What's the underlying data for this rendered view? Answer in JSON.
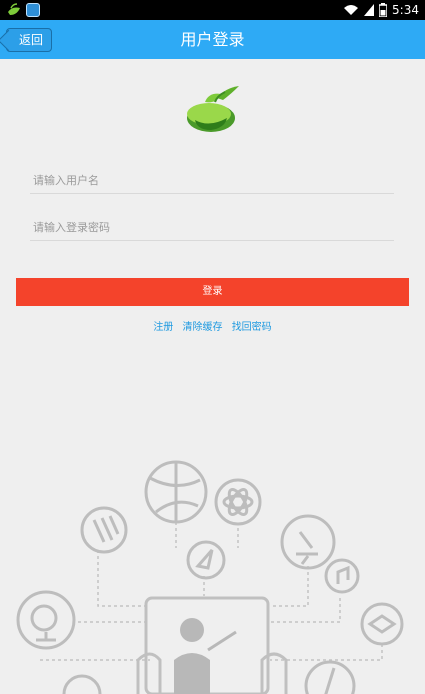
{
  "status_bar": {
    "time": "5:34"
  },
  "header": {
    "back_label": "返回",
    "title": "用户登录"
  },
  "form": {
    "username_placeholder": "请输入用户名",
    "password_placeholder": "请输入登录密码",
    "login_label": "登录"
  },
  "links": {
    "register": "注册",
    "clear_cache": "清除缓存",
    "find_password": "找回密码"
  },
  "colors": {
    "primary": "#2eaaf5",
    "login": "#f4432b",
    "link": "#1f9ae0"
  }
}
